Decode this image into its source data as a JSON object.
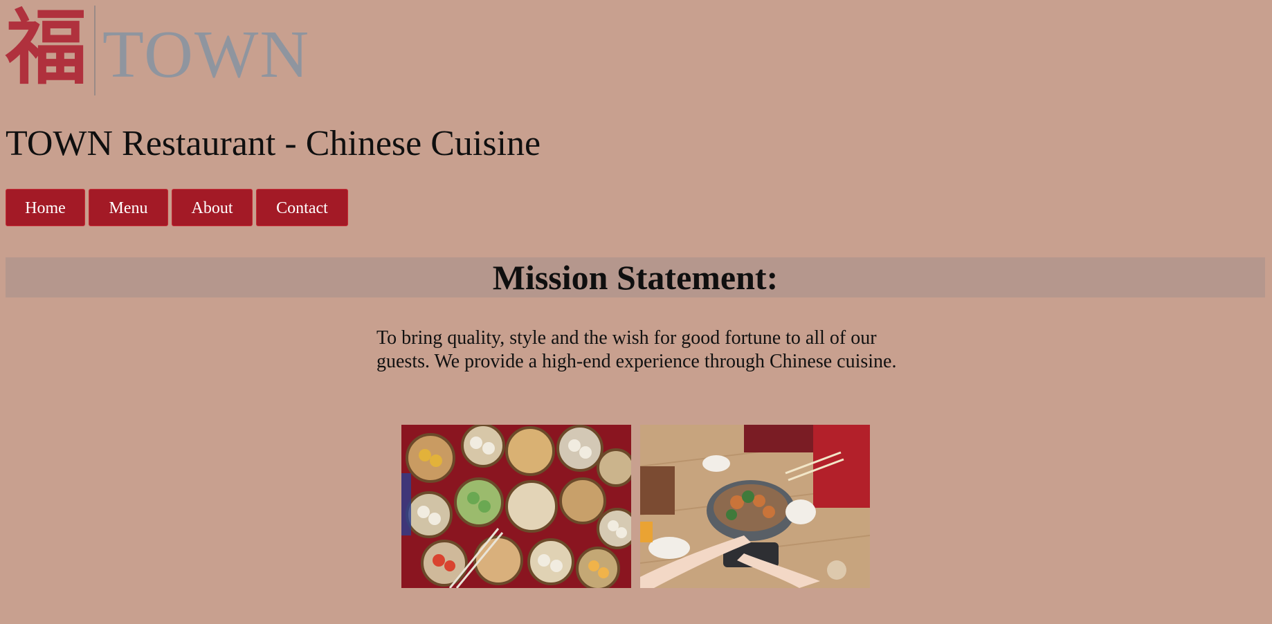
{
  "logo": {
    "char": "福",
    "text": "TOWN"
  },
  "title": "TOWN Restaurant - Chinese Cuisine",
  "nav": {
    "items": [
      {
        "label": "Home"
      },
      {
        "label": "Menu"
      },
      {
        "label": "About"
      },
      {
        "label": "Contact"
      }
    ]
  },
  "mission": {
    "heading": "Mission Statement:",
    "body": "To bring quality, style and the wish for good fortune to all of our guests. We provide a high-end experience through Chinese cuisine."
  },
  "images": {
    "left": {
      "icon": "dim-sum-photo"
    },
    "right": {
      "icon": "shared-dinner-photo"
    }
  },
  "colors": {
    "page_bg": "#c8a08f",
    "nav_button": "#a31a26",
    "heading_bar": "#b5978d",
    "logo_red": "#b0313d",
    "logo_grey": "#8f959f"
  }
}
